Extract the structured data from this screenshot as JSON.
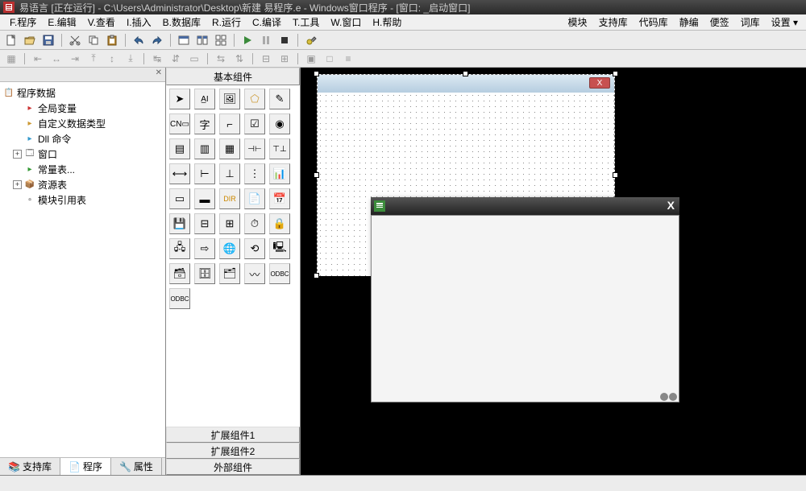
{
  "titlebar": {
    "text": "易语言 [正在运行] - C:\\Users\\Administrator\\Desktop\\新建 易程序.e - Windows窗口程序 - [窗口: _启动窗口]"
  },
  "menus": {
    "items": [
      "F.程序",
      "E.编辑",
      "V.查看",
      "I.插入",
      "B.数据库",
      "R.运行",
      "C.编译",
      "T.工具",
      "W.窗口",
      "H.帮助"
    ],
    "right": [
      "模块",
      "支持库",
      "代码库",
      "静编",
      "便签",
      "词库",
      "设置 ▾"
    ]
  },
  "toolbar1": {
    "icons": [
      "new",
      "open",
      "save",
      "cut",
      "copy",
      "paste",
      "undo",
      "redo",
      "panes1",
      "panes2",
      "panes3",
      "run",
      "pause",
      "stop",
      "build"
    ]
  },
  "toolbar2": {
    "icons": [
      "grid",
      "align-left",
      "align-hcenter",
      "align-right",
      "align-top",
      "align-vcenter",
      "align-bottom",
      "same-width",
      "same-height",
      "same-size",
      "hspace",
      "vspace",
      "center-h",
      "center-v",
      "front",
      "back",
      "tab-order"
    ]
  },
  "left_panel": {
    "header": "",
    "tree": {
      "root": "程序数据",
      "children": [
        {
          "label": "全局变量"
        },
        {
          "label": "自定义数据类型"
        },
        {
          "label": "Dll 命令"
        },
        {
          "label": "窗口",
          "expandable": true
        },
        {
          "label": "常量表..."
        },
        {
          "label": "资源表",
          "expandable": true
        },
        {
          "label": "模块引用表"
        }
      ]
    },
    "tabs": [
      {
        "label": "支持库",
        "icon": "book"
      },
      {
        "label": "程序",
        "icon": "app"
      },
      {
        "label": "属性",
        "icon": "prop"
      }
    ]
  },
  "comp_panel": {
    "header": "基本组件",
    "items": [
      "pointer",
      "label",
      "picture",
      "shape",
      "draw",
      "edit",
      "char",
      "corner",
      "check",
      "radio",
      "list",
      "combo",
      "grid",
      "slider",
      "vslider",
      "hscroll",
      "rule",
      "vrule",
      "broken",
      "chart",
      "panel",
      "progress",
      "dir",
      "doc",
      "calendar",
      "drive",
      "tree",
      "grid2",
      "timer",
      "lock",
      "sock",
      "send",
      "explorer",
      "marquee",
      "net",
      "db1",
      "db2",
      "db3",
      "wave",
      "odbc1",
      "odbc2"
    ],
    "footer": [
      "扩展组件1",
      "扩展组件2",
      "外部组件"
    ]
  },
  "designer": {
    "close_label": "X"
  },
  "runtime": {
    "close_label": "X"
  }
}
